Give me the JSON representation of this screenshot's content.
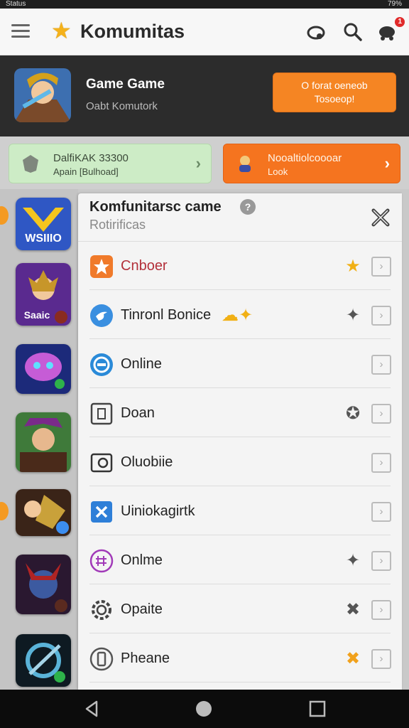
{
  "status": {
    "left": "Status",
    "right": "79%"
  },
  "app_bar": {
    "title": "Komumitas",
    "notify_count": "1"
  },
  "hero": {
    "name": "Game Game",
    "subtitle": "Oabt  Komutork",
    "join_label": "O forat oeneob\nTosoeop!"
  },
  "quick": [
    {
      "title": "DalfiKAK 33300",
      "subtitle": "Apain     [Bulhoad]"
    },
    {
      "title": "Nooaltiolcoooar",
      "subtitle": "Look"
    }
  ],
  "rail": {
    "tile_caption_1": "WSIIIO",
    "tile_caption_2": "Saaic"
  },
  "panel": {
    "title": "Komfunitarsc came",
    "subtitle": "Rotirificas",
    "rows": [
      {
        "label": "Cnboer",
        "badge": "★",
        "color": "#c0392b"
      },
      {
        "label": "Tinronl Bonice",
        "badge": "✦"
      },
      {
        "label": "Online",
        "badge": ""
      },
      {
        "label": "Doan",
        "badge": "✪"
      },
      {
        "label": "Oluobiie",
        "badge": ""
      },
      {
        "label": "Uiniokagirtk",
        "badge": ""
      },
      {
        "label": "Onlme",
        "badge": "✦"
      },
      {
        "label": "Opaite",
        "badge": "✖"
      },
      {
        "label": "Pheane",
        "badge": "✖"
      }
    ]
  },
  "colors": {
    "accent_orange": "#f58523",
    "star_gold": "#f5b21c",
    "hero_bg": "#2c2c2c"
  }
}
